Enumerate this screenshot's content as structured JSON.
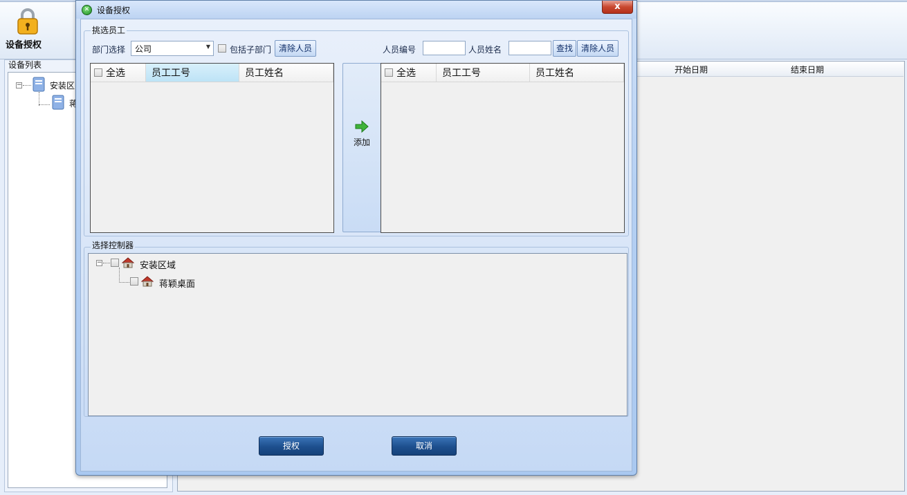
{
  "app": {
    "toolbar_label": "设备授权",
    "device_panel_title": "设备列表",
    "tree_root": "安装区",
    "tree_child": "蒋",
    "grid_columns": [
      "开始日期",
      "结束日期"
    ]
  },
  "dialog": {
    "title": "设备授权",
    "close_label": "x",
    "pick_group": {
      "legend": "挑选员工",
      "dept_label": "部门选择",
      "dept_value": "公司",
      "include_sub_label": "包括子部门",
      "clear_label": "清除人员",
      "emp_no_label": "人员编号",
      "emp_name_label": "人员姓名",
      "emp_no_value": "",
      "emp_name_value": "",
      "find_label": "查找",
      "clear_label_2": "清除人员"
    },
    "left_grid": {
      "select_all": "全选",
      "columns": [
        "员工工号",
        "员工姓名"
      ]
    },
    "add_label": "添加",
    "right_grid": {
      "select_all": "全选",
      "columns": [
        "员工工号",
        "员工姓名"
      ]
    },
    "controller_group": {
      "legend": "选择控制器",
      "root": "安装区域",
      "child": "蒋颖桌面"
    },
    "authorize_label": "授权",
    "cancel_label": "取消"
  },
  "colors": {
    "dialog_frame": "#5f7fa8",
    "action_button": "#1d4f8e",
    "close_button": "#c8482f"
  }
}
